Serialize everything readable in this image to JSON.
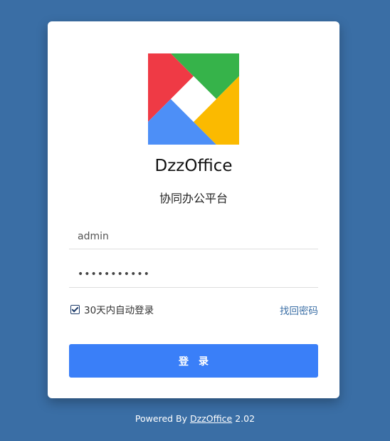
{
  "brand": {
    "name": "DzzOffice",
    "subtitle": "协同办公平台",
    "logo_colors": {
      "red": "#ef3a45",
      "green": "#36b34a",
      "blue": "#4d8ff7",
      "yellow": "#fbba00"
    }
  },
  "form": {
    "username_value": "admin",
    "password_masked": "•••••••••••",
    "remember_label": "30天内自动登录",
    "remember_checked": true,
    "forgot_label": "找回密码",
    "login_label": "登录"
  },
  "footer": {
    "prefix": "Powered By ",
    "link": "DzzOffice",
    "version": " 2.02"
  },
  "colors": {
    "background": "#3a6ea5",
    "button": "#3a7ff8",
    "link": "#3a6ea5"
  }
}
